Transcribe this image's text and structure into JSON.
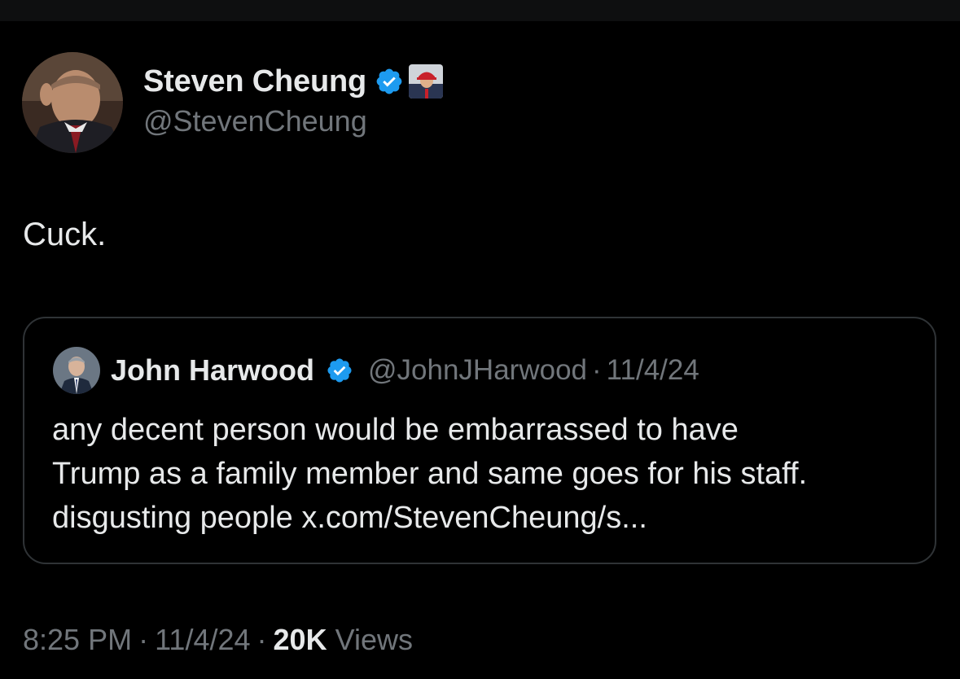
{
  "tweet": {
    "author": {
      "name": "Steven Cheung",
      "handle": "@StevenCheung",
      "verified": true,
      "avatar_icon": "person-avatar",
      "affiliation_icon": "affiliation-badge"
    },
    "text": "Cuck.",
    "quoted": {
      "author_name": "John Harwood",
      "author_handle": "@JohnJHarwood",
      "verified": true,
      "date": "11/4/24",
      "body_lines": [
        "any decent person would be embarrassed to have",
        "Trump as a family member and same goes for his staff.",
        "disgusting people x.com/StevenCheung/s..."
      ]
    },
    "meta": {
      "time": "8:25 PM",
      "date": "11/4/24",
      "views_count": "20K",
      "views_label": "Views"
    }
  },
  "colors": {
    "background": "#000000",
    "text_primary": "#e7e9ea",
    "text_secondary": "#71767b",
    "verified_blue": "#1d9bf0",
    "card_border": "#2f3336"
  }
}
